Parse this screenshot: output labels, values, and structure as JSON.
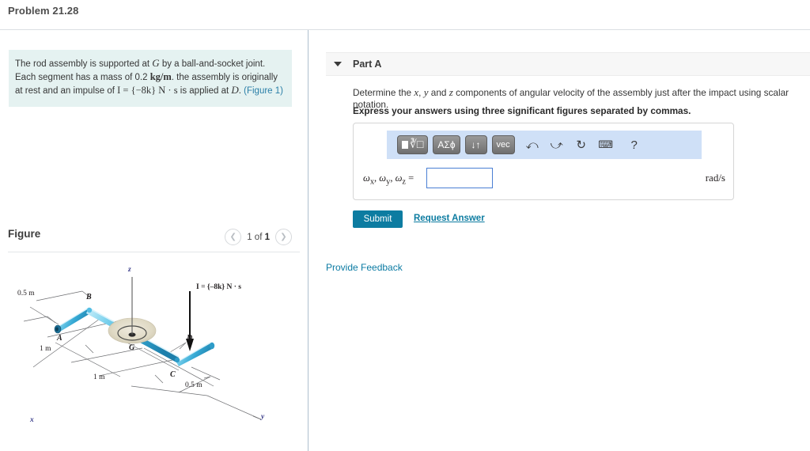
{
  "header": {
    "problem_title": "Problem 21.28"
  },
  "problem": {
    "text_part1": "The rod assembly is supported at ",
    "point_g": "G",
    "text_part2": " by a ball-and-socket joint. Each segment has a mass of 0.2 ",
    "mass_units": "kg/m",
    "text_part3": ". the assembly is originally at rest and an impulse of ",
    "impulse_expr": "I = {−8k} N · s",
    "text_part4": " is applied at ",
    "point_d": "D",
    "text_part5": ". ",
    "figure_link": "(Figure 1)"
  },
  "figure": {
    "label": "Figure",
    "prev_icon": "chevron-left-icon",
    "next_icon": "chevron-right-icon",
    "counter_prefix": "1 of ",
    "counter_total": "1",
    "diagram": {
      "axis_z": "z",
      "axis_x": "x",
      "axis_y": "y",
      "points": [
        "A",
        "B",
        "C",
        "D",
        "G"
      ],
      "dim_ab": "0.5 m",
      "dim_a": "1 m",
      "dim_bottom": "1 m",
      "dim_cd": "0.5 m",
      "impulse_label": "I = {–8k} N · s",
      "rod_color": "#3cb6e0",
      "joint_color": "#ded9c6"
    }
  },
  "part_a": {
    "caret_icon": "caret-down-icon",
    "title": "Part A",
    "question": "Determine the x, y and z components of angular velocity of the assembly just after the impact using scalar notation.",
    "question_pre": "Determine the ",
    "var_x": "x",
    "question_mid1": ", ",
    "var_y": "y",
    "question_mid2": " and ",
    "var_z": "z",
    "question_post": " components of angular velocity of the assembly just after the impact using scalar notation.",
    "instruction": "Express your answers using three significant figures separated by commas.",
    "answer_label": "ωx, ωy, ωz =",
    "answer_value": "",
    "answer_placeholder": "",
    "answer_units": "rad/s",
    "submit_label": "Submit",
    "request_answer_label": "Request Answer",
    "provide_feedback_label": "Provide Feedback",
    "toolbar": {
      "accent_bg": "#cfe0f7",
      "buttons": [
        {
          "name": "template-root-button",
          "label": "√"
        },
        {
          "name": "greek-letters-button",
          "label": "ΑΣϕ"
        },
        {
          "name": "sort-arrows-button",
          "label": "↓↑"
        },
        {
          "name": "vector-button",
          "label": "vec"
        }
      ],
      "icons": [
        {
          "name": "undo-icon",
          "glyph": "↶"
        },
        {
          "name": "redo-icon",
          "glyph": "↷"
        },
        {
          "name": "reset-icon",
          "glyph": "↺"
        },
        {
          "name": "keyboard-icon",
          "glyph": "⌨"
        },
        {
          "name": "help-icon",
          "glyph": "?"
        }
      ]
    }
  },
  "colors": {
    "accent": "#0d7ca1",
    "link": "#0b7ba3",
    "description_bg": "#e5f2f1",
    "input_border": "#4a7fd4"
  }
}
